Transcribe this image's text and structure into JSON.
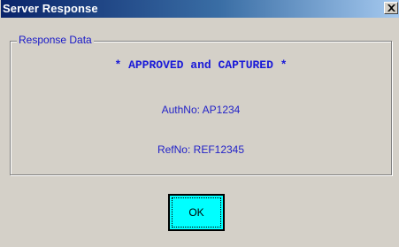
{
  "window": {
    "title": "Server Response",
    "close_icon": "close-icon"
  },
  "group": {
    "legend": "Response Data",
    "status": "* APPROVED and CAPTURED *",
    "auth_no": "AuthNo: AP1234",
    "ref_no": "RefNo:  REF12345"
  },
  "actions": {
    "ok_label": "OK"
  },
  "colors": {
    "title_bar_start": "#0a246a",
    "title_bar_end": "#a6caf0",
    "dialog_face": "#d4d0c8",
    "text_blue": "#1a1ad8",
    "ok_button": "#00ffff"
  }
}
